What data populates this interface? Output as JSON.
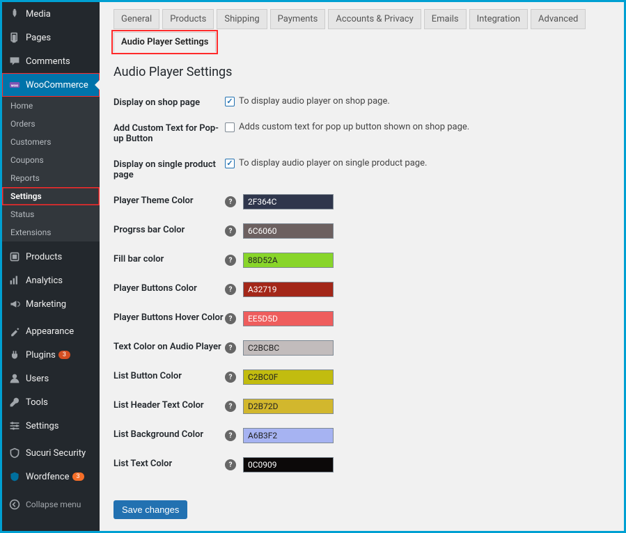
{
  "sidebar": {
    "items": [
      {
        "label": "Media",
        "icon": "media"
      },
      {
        "label": "Pages",
        "icon": "page"
      },
      {
        "label": "Comments",
        "icon": "comment"
      }
    ],
    "woo": {
      "label": "WooCommerce",
      "icon": "woo"
    },
    "subitems": [
      {
        "label": "Home"
      },
      {
        "label": "Orders"
      },
      {
        "label": "Customers"
      },
      {
        "label": "Coupons"
      },
      {
        "label": "Reports"
      },
      {
        "label": "Settings",
        "active": true
      },
      {
        "label": "Status"
      },
      {
        "label": "Extensions"
      }
    ],
    "items2": [
      {
        "label": "Products",
        "icon": "products"
      },
      {
        "label": "Analytics",
        "icon": "analytics"
      },
      {
        "label": "Marketing",
        "icon": "marketing"
      }
    ],
    "items3": [
      {
        "label": "Appearance",
        "icon": "appearance"
      },
      {
        "label": "Plugins",
        "icon": "plugins",
        "badge": "3",
        "badgeColor": "red"
      },
      {
        "label": "Users",
        "icon": "users"
      },
      {
        "label": "Tools",
        "icon": "tools"
      },
      {
        "label": "Settings",
        "icon": "settings"
      }
    ],
    "items4": [
      {
        "label": "Sucuri Security",
        "icon": "sucuri"
      },
      {
        "label": "Wordfence",
        "icon": "wordfence",
        "badge": "3",
        "badgeColor": "orange"
      }
    ],
    "collapse": "Collapse menu"
  },
  "tabs": [
    {
      "label": "General"
    },
    {
      "label": "Products"
    },
    {
      "label": "Shipping"
    },
    {
      "label": "Payments"
    },
    {
      "label": "Accounts & Privacy"
    },
    {
      "label": "Emails"
    },
    {
      "label": "Integration"
    },
    {
      "label": "Advanced"
    },
    {
      "label": "Audio Player Settings",
      "active": true,
      "hl": true
    }
  ],
  "title": "Audio Player Settings",
  "rows": {
    "shop": {
      "label": "Display on shop page",
      "desc": "To display audio player on shop page.",
      "checked": true
    },
    "custom": {
      "label": "Add Custom Text for Pop-up Button",
      "desc": "Adds custom text for pop up button shown on shop page.",
      "checked": false
    },
    "single": {
      "label": "Display on single product page",
      "desc": "To display audio player on single product page.",
      "checked": true
    }
  },
  "colors": [
    {
      "label": "Player Theme Color",
      "value": "2F364C",
      "bg": "#2F364C",
      "dark": false
    },
    {
      "label": "Progrss bar Color",
      "value": "6C6060",
      "bg": "#6C6060",
      "dark": false
    },
    {
      "label": "Fill bar color",
      "value": "88D52A",
      "bg": "#88D52A",
      "dark": true
    },
    {
      "label": "Player Buttons Color",
      "value": "A32719",
      "bg": "#A32719",
      "dark": false
    },
    {
      "label": "Player Buttons Hover Color",
      "value": "EE5D5D",
      "bg": "#EE5D5D",
      "dark": false
    },
    {
      "label": "Text Color on Audio Player",
      "value": "C2BCBC",
      "bg": "#C2BCBC",
      "dark": true
    },
    {
      "label": "List Button Color",
      "value": "C2BC0F",
      "bg": "#C2BC0F",
      "dark": true
    },
    {
      "label": "List Header Text Color",
      "value": "D2B72D",
      "bg": "#D2B72D",
      "dark": true
    },
    {
      "label": "List Background Color",
      "value": "A6B3F2",
      "bg": "#A6B3F2",
      "dark": true
    },
    {
      "label": "List Text Color",
      "value": "0C0909",
      "bg": "#0C0909",
      "dark": false
    }
  ],
  "save": "Save changes"
}
